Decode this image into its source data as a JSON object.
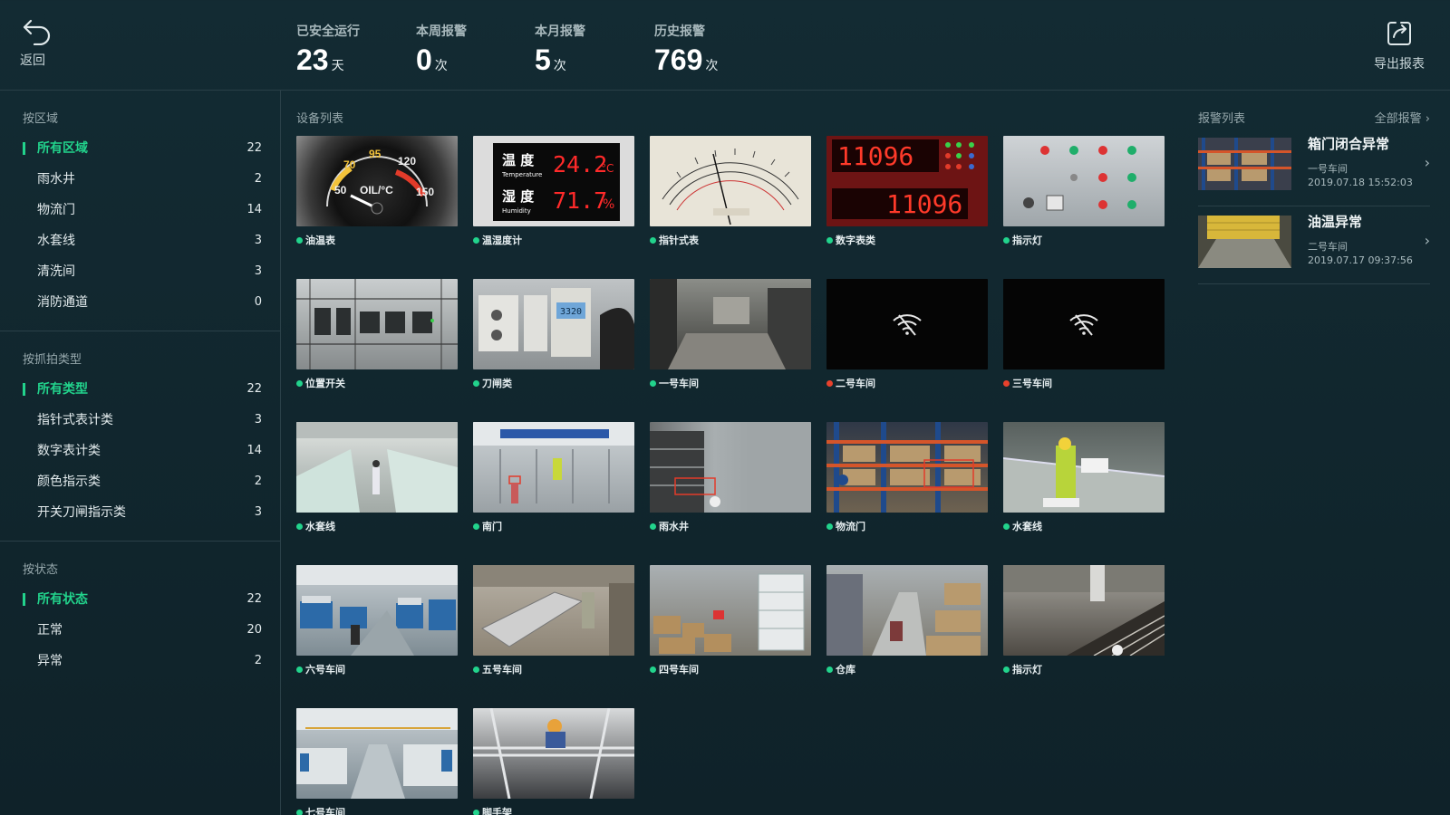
{
  "header": {
    "back_label": "返回",
    "export_label": "导出报表",
    "stats": [
      {
        "title": "已安全运行",
        "value": "23",
        "unit": "天"
      },
      {
        "title": "本周报警",
        "value": "0",
        "unit": "次"
      },
      {
        "title": "本月报警",
        "value": "5",
        "unit": "次"
      },
      {
        "title": "历史报警",
        "value": "769",
        "unit": "次"
      }
    ]
  },
  "sidebar": {
    "area": {
      "title": "按区域",
      "items": [
        {
          "label": "所有区域",
          "count": "22"
        },
        {
          "label": "雨水井",
          "count": "2"
        },
        {
          "label": "物流门",
          "count": "14"
        },
        {
          "label": "水套线",
          "count": "3"
        },
        {
          "label": "清洗间",
          "count": "3"
        },
        {
          "label": "消防通道",
          "count": "0"
        }
      ]
    },
    "type": {
      "title": "按抓拍类型",
      "items": [
        {
          "label": "所有类型",
          "count": "22"
        },
        {
          "label": "指针式表计类",
          "count": "3"
        },
        {
          "label": "数字表计类",
          "count": "14"
        },
        {
          "label": "颜色指示类",
          "count": "2"
        },
        {
          "label": "开关刀闸指示类",
          "count": "3"
        }
      ]
    },
    "status": {
      "title": "按状态",
      "items": [
        {
          "label": "所有状态",
          "count": "22"
        },
        {
          "label": "正常",
          "count": "20"
        },
        {
          "label": "异常",
          "count": "2"
        }
      ]
    }
  },
  "devices": {
    "title": "设备列表",
    "items": [
      {
        "label": "油温表",
        "status": "normal"
      },
      {
        "label": "温湿度计",
        "status": "normal"
      },
      {
        "label": "指针式表",
        "status": "normal"
      },
      {
        "label": "数字表类",
        "status": "normal"
      },
      {
        "label": "指示灯",
        "status": "normal"
      },
      {
        "label": "位置开关",
        "status": "normal"
      },
      {
        "label": "刀闸类",
        "status": "normal"
      },
      {
        "label": "一号车间",
        "status": "normal"
      },
      {
        "label": "二号车间",
        "status": "alarm"
      },
      {
        "label": "三号车间",
        "status": "alarm"
      },
      {
        "label": "水套线",
        "status": "normal"
      },
      {
        "label": "南门",
        "status": "normal"
      },
      {
        "label": "雨水井",
        "status": "normal"
      },
      {
        "label": "物流门",
        "status": "normal"
      },
      {
        "label": "水套线",
        "status": "normal"
      },
      {
        "label": "六号车间",
        "status": "normal"
      },
      {
        "label": "五号车间",
        "status": "normal"
      },
      {
        "label": "四号车间",
        "status": "normal"
      },
      {
        "label": "仓库",
        "status": "normal"
      },
      {
        "label": "指示灯",
        "status": "normal"
      },
      {
        "label": "七号车间",
        "status": "normal"
      },
      {
        "label": "脚手架",
        "status": "normal"
      }
    ],
    "thumb_text": {
      "gauge_ticks": [
        "70",
        "95",
        "120",
        "50",
        "150"
      ],
      "gauge_unit": "OIL/°C",
      "lcd_temp_label": "温 度",
      "lcd_temp_en": "Temperature",
      "lcd_temp_value": "24.2",
      "lcd_temp_unit": "°C",
      "lcd_hum_label": "湿 度",
      "lcd_hum_en": "Humidity",
      "lcd_hum_value": "71.7",
      "lcd_hum_unit": "%",
      "digital_top": "11096",
      "digital_bottom": "11096",
      "breaker_display": "3320"
    }
  },
  "alarms": {
    "title": "报警列表",
    "all_label": "全部报警",
    "items": [
      {
        "name": "箱门闭合异常",
        "location": "一号车间",
        "time": "2019.07.18 15:52:03"
      },
      {
        "name": "油温异常",
        "location": "二号车间",
        "time": "2019.07.17 09:37:56"
      }
    ]
  },
  "colors": {
    "accent": "#22d38c",
    "normal_dot": "#22d38c",
    "alarm_dot": "#e8412c",
    "background": "#132b33"
  }
}
